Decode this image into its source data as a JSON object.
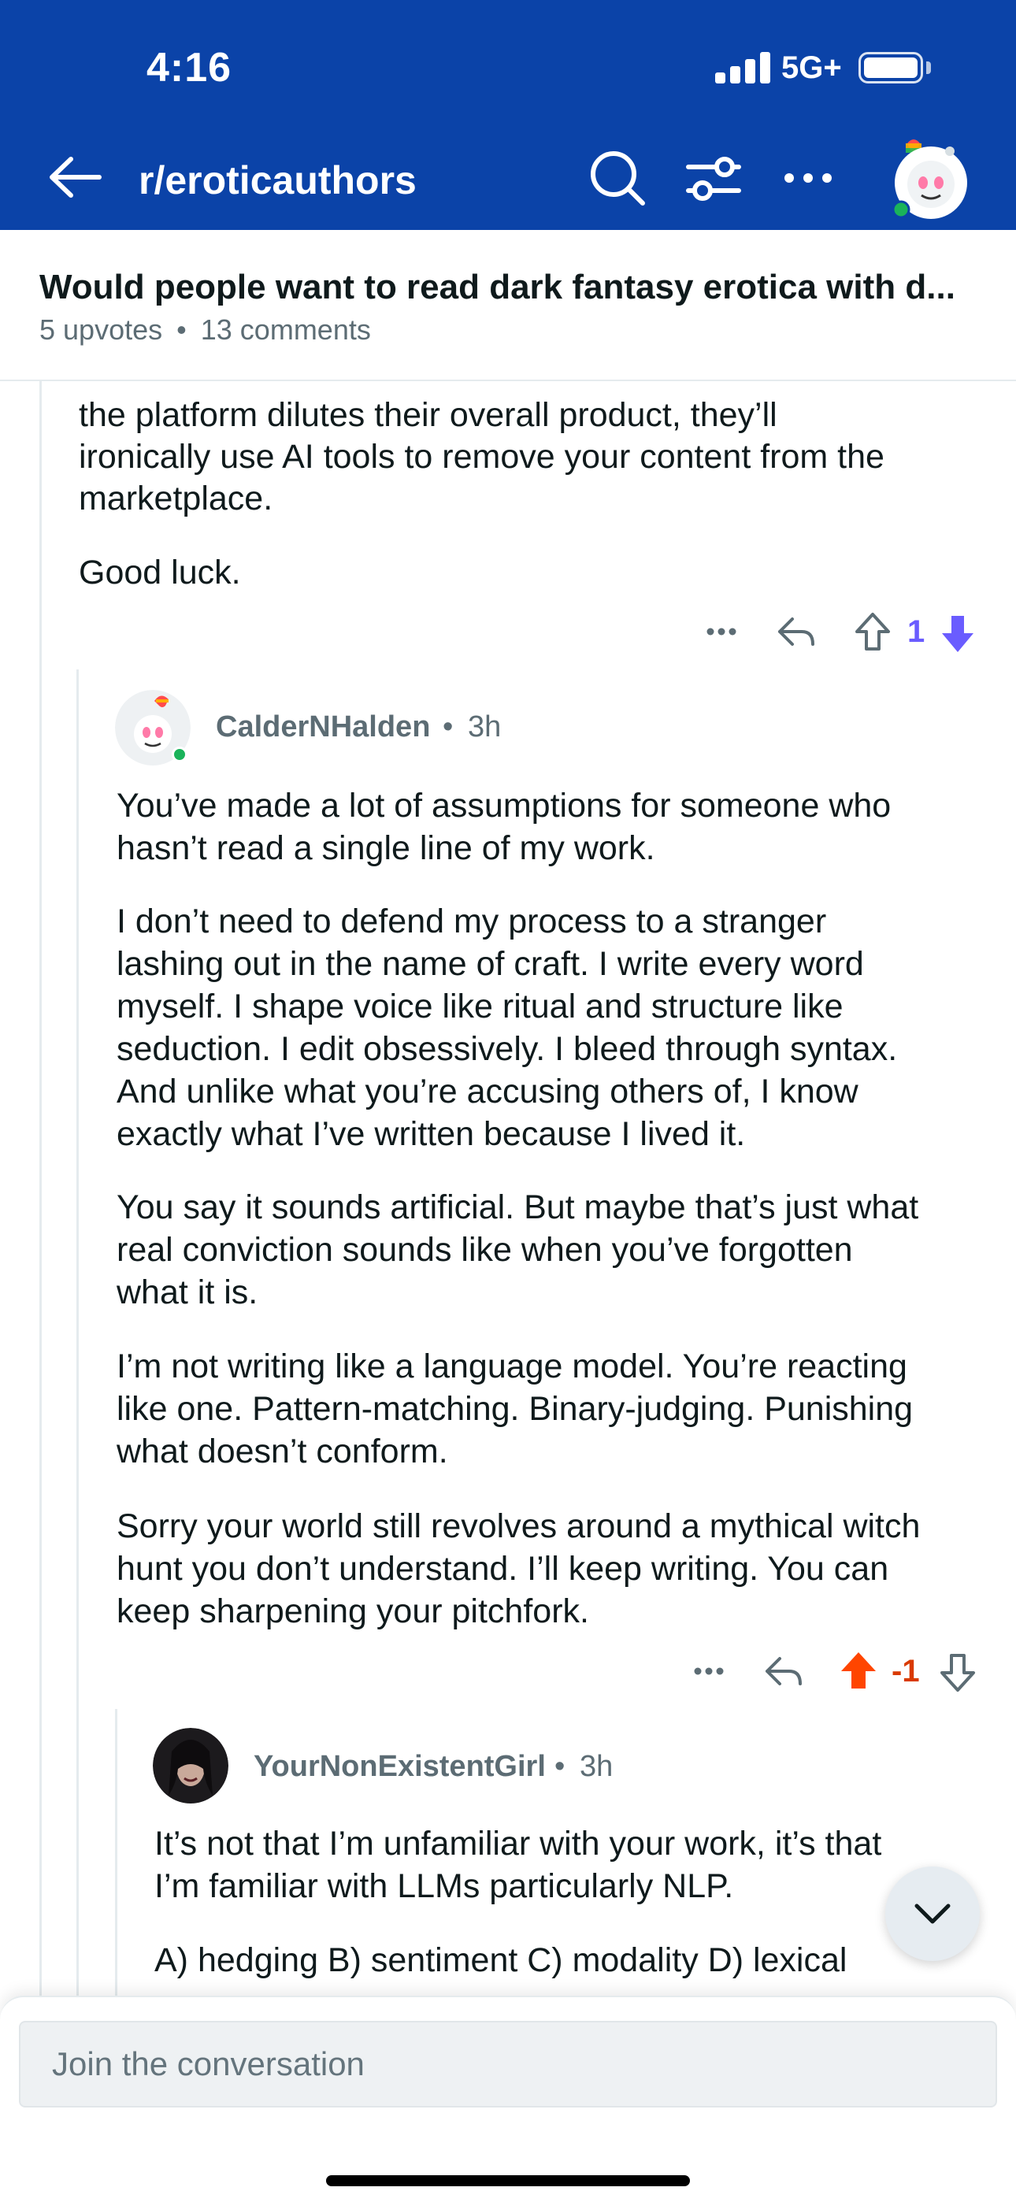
{
  "status_bar": {
    "time": "4:16",
    "network": "5G+"
  },
  "nav": {
    "subreddit": "r/eroticauthors",
    "back_icon": "arrow-left-icon",
    "search_icon": "search-icon",
    "filter_icon": "filter-sliders-icon",
    "more_icon": "more-horizontal-icon"
  },
  "post": {
    "title": "Would people want to read dark fantasy erotica with d...",
    "upvotes": "5 upvotes",
    "separator": "•",
    "comments": "13 comments"
  },
  "comment_parent": {
    "lines": [
      "the platform dilutes their overall product, they’ll",
      "ironically use AI tools to remove your content from the",
      "marketplace.",
      "Good luck."
    ],
    "vote_count": "1",
    "vote_state": "downvoted"
  },
  "comment_calder": {
    "author": "CalderNHalden",
    "time": "3h",
    "separator": "•",
    "lines": [
      "You’ve made a lot of assumptions for someone who",
      "hasn’t read a single line of my work.",
      "I don’t need to defend my process to a stranger",
      "lashing out in the name of craft. I write every word",
      "myself. I shape voice like ritual and structure like",
      "seduction. I edit obsessively. I bleed through syntax.",
      "And unlike what you’re accusing others of, I know",
      "exactly what I’ve written because I lived it.",
      "You say it sounds artificial. But maybe that’s just what",
      "real conviction sounds like when you’ve forgotten",
      "what it is.",
      "I’m not writing like a language model. You’re reacting",
      "like one. Pattern-matching. Binary-judging. Punishing",
      "what doesn’t conform.",
      "Sorry your world still revolves around a mythical witch",
      "hunt you don’t understand. I’ll keep writing. You can",
      "keep sharpening your pitchfork."
    ],
    "vote_count": "-1",
    "vote_state": "upvoted"
  },
  "comment_girl": {
    "author": "YourNonExistentGirl",
    "time": "3h",
    "separator": "•",
    "lines": [
      "It’s not that I’m unfamiliar with your work, it’s that",
      "I’m familiar with LLMs particularly NLP.",
      "A) hedging B) sentiment C) modality D) lexical"
    ]
  },
  "composer": {
    "placeholder": "Join the conversation"
  },
  "colors": {
    "header_bg": "#0b43a8",
    "downvote": "#6a5cff",
    "upvote": "#ff4500",
    "meta_text": "#5c6c74"
  }
}
